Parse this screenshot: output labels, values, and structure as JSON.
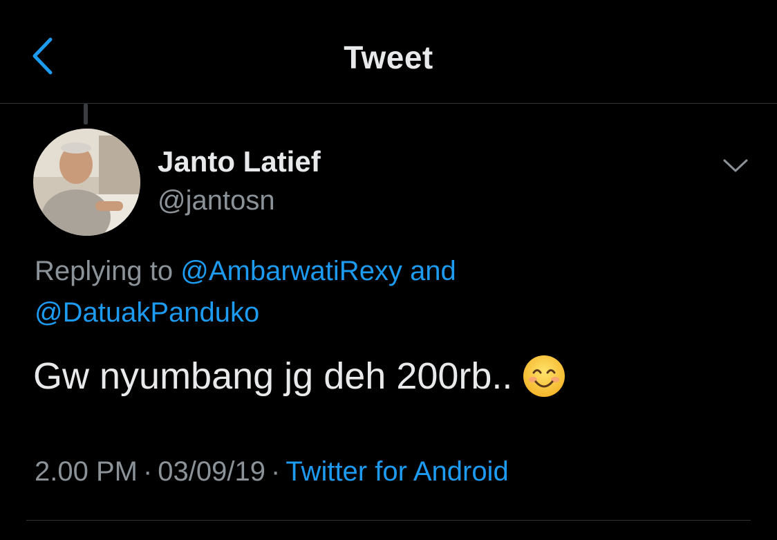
{
  "header": {
    "title": "Tweet",
    "back_icon": "chevron-left-icon"
  },
  "tweet": {
    "author": {
      "name": "Janto Latief",
      "handle": "@jantosn"
    },
    "reply_context": {
      "prefix": "Replying to",
      "mention_1": "@AmbarwatiRexy",
      "joiner": "and",
      "mention_2": "@DatuakPanduko"
    },
    "text": "Gw nyumbang jg deh 200rb..",
    "emoji": "smiling-face-emoji",
    "time": "2.00 PM",
    "date": "03/09/19",
    "separator": "·",
    "source": "Twitter for Android",
    "more_icon": "chevron-down-icon"
  },
  "colors": {
    "background": "#000000",
    "text_primary": "#e7e9ea",
    "text_secondary": "#8b9399",
    "link": "#1d9bf0",
    "divider": "#2f3336"
  }
}
